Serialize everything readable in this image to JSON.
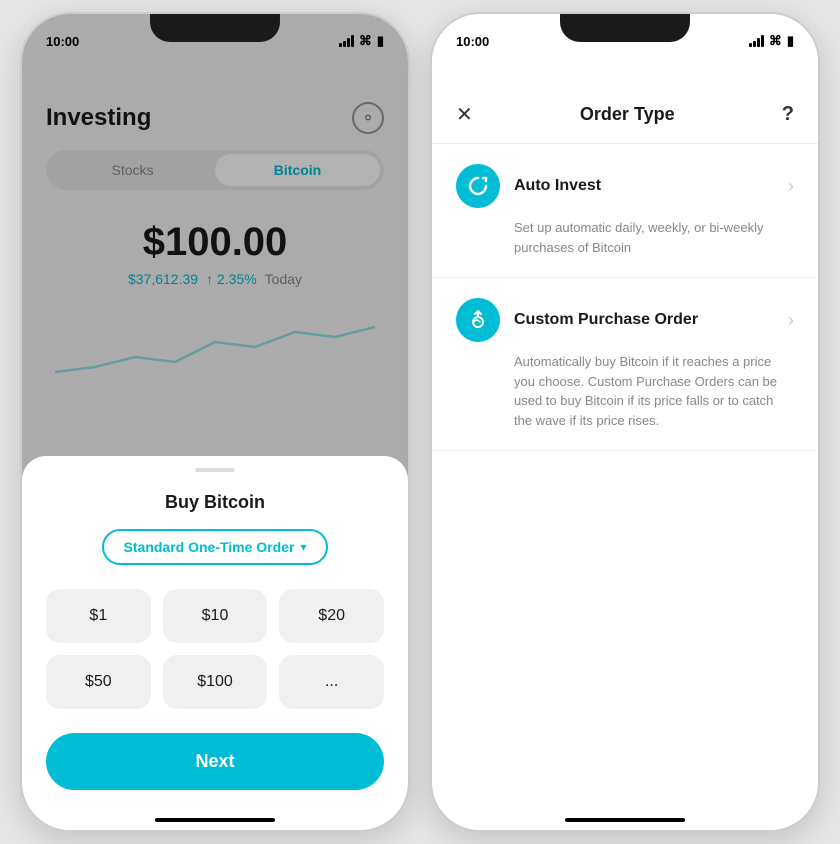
{
  "left_phone": {
    "status_bar": {
      "time": "10:00"
    },
    "header": {
      "title": "Investing"
    },
    "tabs": [
      {
        "label": "Stocks",
        "active": false
      },
      {
        "label": "Bitcoin",
        "active": true
      }
    ],
    "price": {
      "main": "$100.00",
      "btc_price": "$37,612.39",
      "change": "↑ 2.35%",
      "period": "Today"
    },
    "sheet": {
      "title": "Buy Bitcoin",
      "order_type": "Standard One-Time Order",
      "amounts": [
        "$1",
        "$10",
        "$20",
        "$50",
        "$100",
        "..."
      ],
      "next_button": "Next"
    }
  },
  "right_phone": {
    "status_bar": {
      "time": "10:00"
    },
    "header": {
      "title": "Order Type",
      "close": "✕",
      "help": "?"
    },
    "options": [
      {
        "name": "Auto Invest",
        "icon": "↺",
        "description": "Set up automatic daily, weekly, or bi-weekly purchases of Bitcoin"
      },
      {
        "name": "Custom Purchase Order",
        "icon": "↗",
        "description": "Automatically buy Bitcoin if it reaches a price you choose. Custom Purchase Orders can be used to buy Bitcoin if its price falls or to catch the wave if its price rises."
      }
    ]
  }
}
